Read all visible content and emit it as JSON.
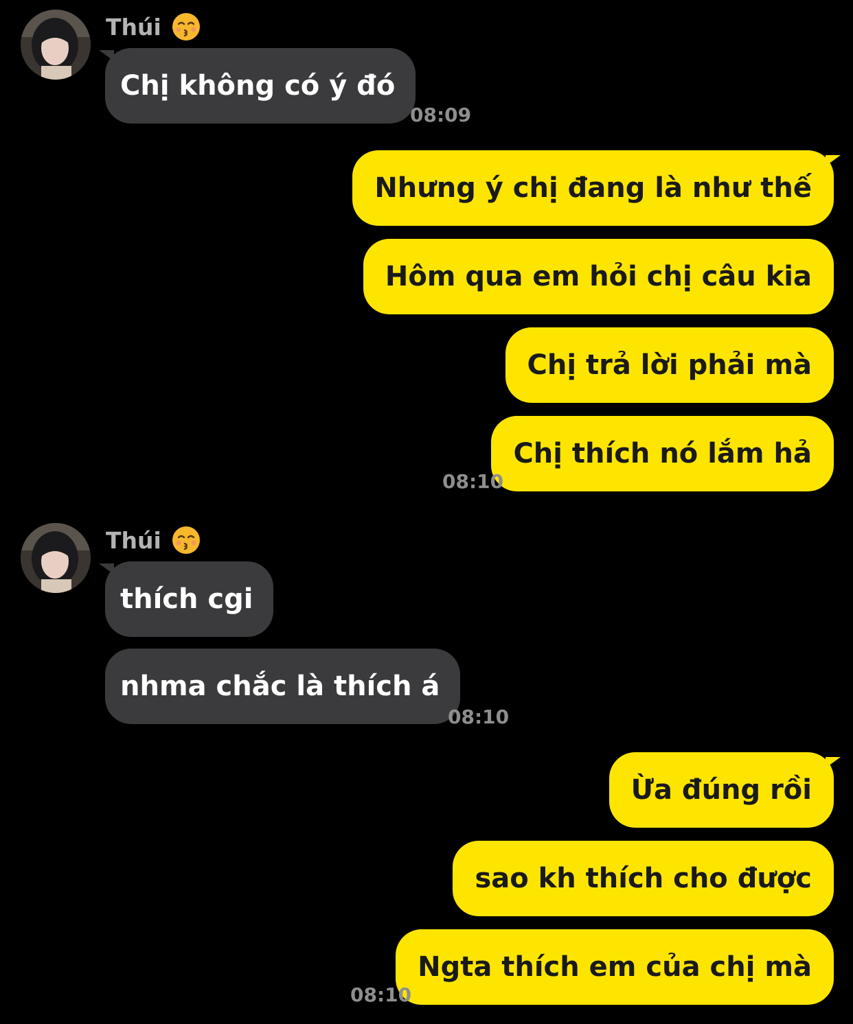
{
  "colors": {
    "background": "#000000",
    "incoming_bubble": "#3b3b3d",
    "outgoing_bubble": "#fee500",
    "timestamp": "#8e8e8e",
    "sender_name": "#b3b3b3"
  },
  "group1": {
    "sender": "Thúi",
    "emoji": "kissing-face-closed-eyes-emoji",
    "messages": [
      "Chị không có ý đó"
    ],
    "time": "08:09"
  },
  "group2": {
    "messages": [
      "Nhưng ý chị đang là như thế",
      "Hôm qua em hỏi chị câu kia",
      "Chị trả lời phải mà",
      "Chị thích nó lắm hả"
    ],
    "time": "08:10"
  },
  "group3": {
    "sender": "Thúi",
    "emoji": "kissing-face-closed-eyes-emoji",
    "messages": [
      "thích cgi",
      "nhma chắc là thích á"
    ],
    "time": "08:10"
  },
  "group4": {
    "messages": [
      "Ừa đúng rồi",
      "sao kh thích cho được",
      "Ngta thích em của chị mà"
    ],
    "time": "08:10"
  }
}
